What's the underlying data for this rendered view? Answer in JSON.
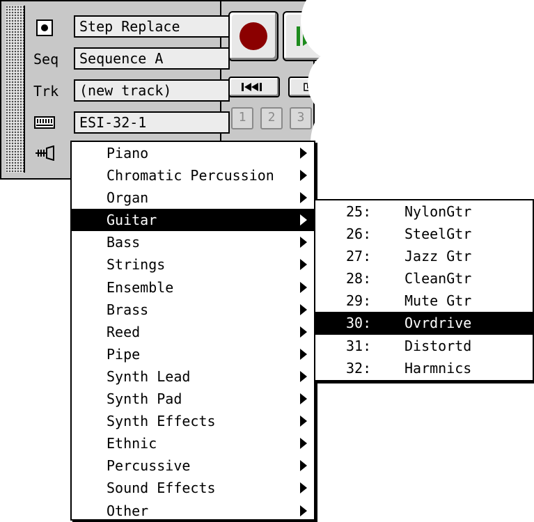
{
  "controls": {
    "mode_value": "Step Replace",
    "seq_label": "Seq",
    "seq_value": "Sequence A",
    "trk_label": "Trk",
    "trk_value": "(new track)",
    "device_value": "ESI-32-1"
  },
  "transport": {
    "num_buttons": [
      "1",
      "2",
      "3"
    ]
  },
  "icons": {
    "mode": "record-mode-icon",
    "device": "keyboard-icon",
    "patch": "instrument-icon",
    "rewind": "rewind-icon",
    "play": "play-icon",
    "record": "record-icon"
  },
  "colors": {
    "record": "#8b0000",
    "play": "#1e8c1e",
    "selection": "#000000"
  },
  "menu": {
    "items": [
      {
        "label": "Piano"
      },
      {
        "label": "Chromatic Percussion"
      },
      {
        "label": "Organ"
      },
      {
        "label": "Guitar",
        "selected": true
      },
      {
        "label": "Bass"
      },
      {
        "label": "Strings"
      },
      {
        "label": "Ensemble"
      },
      {
        "label": "Brass"
      },
      {
        "label": "Reed"
      },
      {
        "label": "Pipe"
      },
      {
        "label": "Synth Lead"
      },
      {
        "label": "Synth Pad"
      },
      {
        "label": "Synth Effects"
      },
      {
        "label": "Ethnic"
      },
      {
        "label": "Percussive"
      },
      {
        "label": "Sound Effects"
      },
      {
        "label": "Other"
      }
    ]
  },
  "submenu": {
    "items": [
      {
        "num": "25:",
        "name": "NylonGtr"
      },
      {
        "num": "26:",
        "name": "SteelGtr"
      },
      {
        "num": "27:",
        "name": "Jazz Gtr"
      },
      {
        "num": "28:",
        "name": "CleanGtr"
      },
      {
        "num": "29:",
        "name": "Mute Gtr"
      },
      {
        "num": "30:",
        "name": "Ovrdrive",
        "selected": true
      },
      {
        "num": "31:",
        "name": "Distortd"
      },
      {
        "num": "32:",
        "name": "Harmnics"
      }
    ]
  }
}
